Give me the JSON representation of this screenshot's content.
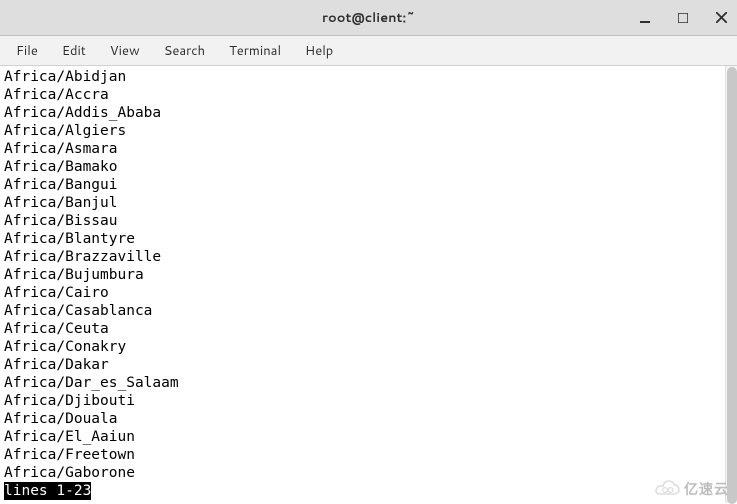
{
  "window": {
    "title": "root@client:~"
  },
  "menubar": {
    "items": [
      {
        "label": "File"
      },
      {
        "label": "Edit"
      },
      {
        "label": "View"
      },
      {
        "label": "Search"
      },
      {
        "label": "Terminal"
      },
      {
        "label": "Help"
      }
    ]
  },
  "terminal": {
    "lines": [
      "Africa/Abidjan",
      "Africa/Accra",
      "Africa/Addis_Ababa",
      "Africa/Algiers",
      "Africa/Asmara",
      "Africa/Bamako",
      "Africa/Bangui",
      "Africa/Banjul",
      "Africa/Bissau",
      "Africa/Blantyre",
      "Africa/Brazzaville",
      "Africa/Bujumbura",
      "Africa/Cairo",
      "Africa/Casablanca",
      "Africa/Ceuta",
      "Africa/Conakry",
      "Africa/Dakar",
      "Africa/Dar_es_Salaam",
      "Africa/Djibouti",
      "Africa/Douala",
      "Africa/El_Aaiun",
      "Africa/Freetown",
      "Africa/Gaborone"
    ],
    "status": "lines 1-23"
  },
  "watermark": {
    "text": "亿速云"
  }
}
